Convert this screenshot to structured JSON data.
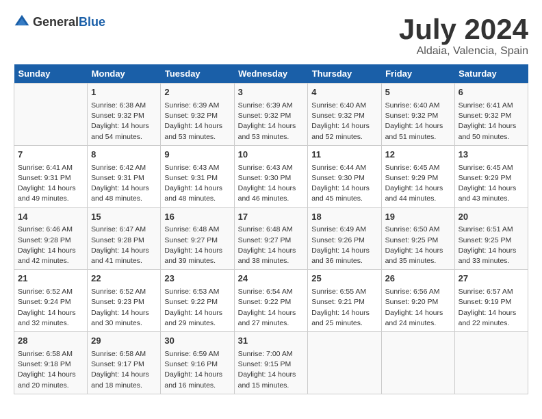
{
  "header": {
    "logo_general": "General",
    "logo_blue": "Blue",
    "main_title": "July 2024",
    "subtitle": "Aldaia, Valencia, Spain"
  },
  "columns": [
    "Sunday",
    "Monday",
    "Tuesday",
    "Wednesday",
    "Thursday",
    "Friday",
    "Saturday"
  ],
  "weeks": [
    [
      {
        "day": "",
        "lines": []
      },
      {
        "day": "1",
        "lines": [
          "Sunrise: 6:38 AM",
          "Sunset: 9:32 PM",
          "Daylight: 14 hours",
          "and 54 minutes."
        ]
      },
      {
        "day": "2",
        "lines": [
          "Sunrise: 6:39 AM",
          "Sunset: 9:32 PM",
          "Daylight: 14 hours",
          "and 53 minutes."
        ]
      },
      {
        "day": "3",
        "lines": [
          "Sunrise: 6:39 AM",
          "Sunset: 9:32 PM",
          "Daylight: 14 hours",
          "and 53 minutes."
        ]
      },
      {
        "day": "4",
        "lines": [
          "Sunrise: 6:40 AM",
          "Sunset: 9:32 PM",
          "Daylight: 14 hours",
          "and 52 minutes."
        ]
      },
      {
        "day": "5",
        "lines": [
          "Sunrise: 6:40 AM",
          "Sunset: 9:32 PM",
          "Daylight: 14 hours",
          "and 51 minutes."
        ]
      },
      {
        "day": "6",
        "lines": [
          "Sunrise: 6:41 AM",
          "Sunset: 9:32 PM",
          "Daylight: 14 hours",
          "and 50 minutes."
        ]
      }
    ],
    [
      {
        "day": "7",
        "lines": [
          "Sunrise: 6:41 AM",
          "Sunset: 9:31 PM",
          "Daylight: 14 hours",
          "and 49 minutes."
        ]
      },
      {
        "day": "8",
        "lines": [
          "Sunrise: 6:42 AM",
          "Sunset: 9:31 PM",
          "Daylight: 14 hours",
          "and 48 minutes."
        ]
      },
      {
        "day": "9",
        "lines": [
          "Sunrise: 6:43 AM",
          "Sunset: 9:31 PM",
          "Daylight: 14 hours",
          "and 48 minutes."
        ]
      },
      {
        "day": "10",
        "lines": [
          "Sunrise: 6:43 AM",
          "Sunset: 9:30 PM",
          "Daylight: 14 hours",
          "and 46 minutes."
        ]
      },
      {
        "day": "11",
        "lines": [
          "Sunrise: 6:44 AM",
          "Sunset: 9:30 PM",
          "Daylight: 14 hours",
          "and 45 minutes."
        ]
      },
      {
        "day": "12",
        "lines": [
          "Sunrise: 6:45 AM",
          "Sunset: 9:29 PM",
          "Daylight: 14 hours",
          "and 44 minutes."
        ]
      },
      {
        "day": "13",
        "lines": [
          "Sunrise: 6:45 AM",
          "Sunset: 9:29 PM",
          "Daylight: 14 hours",
          "and 43 minutes."
        ]
      }
    ],
    [
      {
        "day": "14",
        "lines": [
          "Sunrise: 6:46 AM",
          "Sunset: 9:28 PM",
          "Daylight: 14 hours",
          "and 42 minutes."
        ]
      },
      {
        "day": "15",
        "lines": [
          "Sunrise: 6:47 AM",
          "Sunset: 9:28 PM",
          "Daylight: 14 hours",
          "and 41 minutes."
        ]
      },
      {
        "day": "16",
        "lines": [
          "Sunrise: 6:48 AM",
          "Sunset: 9:27 PM",
          "Daylight: 14 hours",
          "and 39 minutes."
        ]
      },
      {
        "day": "17",
        "lines": [
          "Sunrise: 6:48 AM",
          "Sunset: 9:27 PM",
          "Daylight: 14 hours",
          "and 38 minutes."
        ]
      },
      {
        "day": "18",
        "lines": [
          "Sunrise: 6:49 AM",
          "Sunset: 9:26 PM",
          "Daylight: 14 hours",
          "and 36 minutes."
        ]
      },
      {
        "day": "19",
        "lines": [
          "Sunrise: 6:50 AM",
          "Sunset: 9:25 PM",
          "Daylight: 14 hours",
          "and 35 minutes."
        ]
      },
      {
        "day": "20",
        "lines": [
          "Sunrise: 6:51 AM",
          "Sunset: 9:25 PM",
          "Daylight: 14 hours",
          "and 33 minutes."
        ]
      }
    ],
    [
      {
        "day": "21",
        "lines": [
          "Sunrise: 6:52 AM",
          "Sunset: 9:24 PM",
          "Daylight: 14 hours",
          "and 32 minutes."
        ]
      },
      {
        "day": "22",
        "lines": [
          "Sunrise: 6:52 AM",
          "Sunset: 9:23 PM",
          "Daylight: 14 hours",
          "and 30 minutes."
        ]
      },
      {
        "day": "23",
        "lines": [
          "Sunrise: 6:53 AM",
          "Sunset: 9:22 PM",
          "Daylight: 14 hours",
          "and 29 minutes."
        ]
      },
      {
        "day": "24",
        "lines": [
          "Sunrise: 6:54 AM",
          "Sunset: 9:22 PM",
          "Daylight: 14 hours",
          "and 27 minutes."
        ]
      },
      {
        "day": "25",
        "lines": [
          "Sunrise: 6:55 AM",
          "Sunset: 9:21 PM",
          "Daylight: 14 hours",
          "and 25 minutes."
        ]
      },
      {
        "day": "26",
        "lines": [
          "Sunrise: 6:56 AM",
          "Sunset: 9:20 PM",
          "Daylight: 14 hours",
          "and 24 minutes."
        ]
      },
      {
        "day": "27",
        "lines": [
          "Sunrise: 6:57 AM",
          "Sunset: 9:19 PM",
          "Daylight: 14 hours",
          "and 22 minutes."
        ]
      }
    ],
    [
      {
        "day": "28",
        "lines": [
          "Sunrise: 6:58 AM",
          "Sunset: 9:18 PM",
          "Daylight: 14 hours",
          "and 20 minutes."
        ]
      },
      {
        "day": "29",
        "lines": [
          "Sunrise: 6:58 AM",
          "Sunset: 9:17 PM",
          "Daylight: 14 hours",
          "and 18 minutes."
        ]
      },
      {
        "day": "30",
        "lines": [
          "Sunrise: 6:59 AM",
          "Sunset: 9:16 PM",
          "Daylight: 14 hours",
          "and 16 minutes."
        ]
      },
      {
        "day": "31",
        "lines": [
          "Sunrise: 7:00 AM",
          "Sunset: 9:15 PM",
          "Daylight: 14 hours",
          "and 15 minutes."
        ]
      },
      {
        "day": "",
        "lines": []
      },
      {
        "day": "",
        "lines": []
      },
      {
        "day": "",
        "lines": []
      }
    ]
  ]
}
